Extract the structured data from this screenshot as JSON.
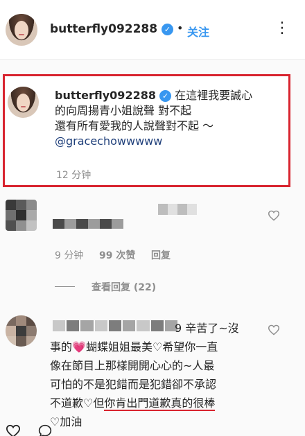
{
  "header": {
    "username": "butterfly092288",
    "separator": "•",
    "follow_label": "关注",
    "more_label": "⋮"
  },
  "caption": {
    "username": "butterfly092288",
    "line1": "在這裡我要誠心",
    "line2": "的向周揚青小姐說聲 對不起",
    "line3": "還有所有愛我的人說聲對不起 ～",
    "mention": "@gracechowwwww",
    "time": "12 分钟"
  },
  "comment1": {
    "time": "9 分钟",
    "likes": "99 次赞",
    "reply_label": "回复",
    "view_replies": "查看回复 (22)"
  },
  "comment2": {
    "line1_tail": "9 辛苦了~沒",
    "line2_a": "事的",
    "line2_heart": "💗",
    "line2_b": "蝴蝶姐姐最美♡希望你一直",
    "line3": "像在節目上那樣開開心心的~人最",
    "line4": "可怕的不是犯錯而是犯錯卻不承認",
    "line5_a": "不道歉♡但",
    "line5_underlined": "你肯出門道歉真的很棒",
    "line6": "♡加油"
  },
  "icons": {
    "verified": "verified-badge-icon",
    "heart": "heart-outline-icon",
    "comment": "comment-bubble-icon"
  },
  "colors": {
    "accent_blue": "#3897f0",
    "highlight_red": "#d8242f",
    "muted_gray": "#8e8e8e",
    "mention": "#1f3f7a"
  }
}
